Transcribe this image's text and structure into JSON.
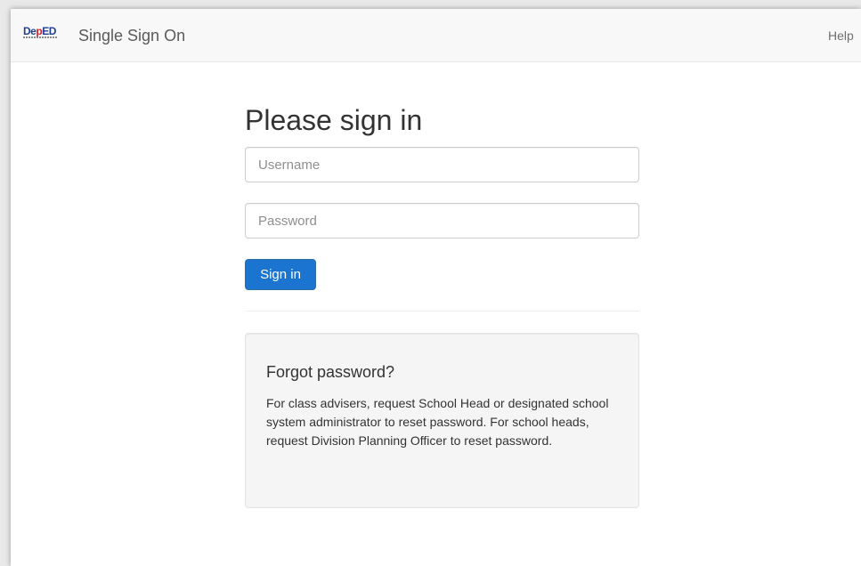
{
  "header": {
    "logo": "DepED",
    "brand": "Single Sign On",
    "help": "Help"
  },
  "form": {
    "title": "Please sign in",
    "username_placeholder": "Username",
    "password_placeholder": "Password",
    "submit_label": "Sign in"
  },
  "forgot": {
    "title": "Forgot password?",
    "text": "For class advisers, request School Head or designated school system administrator to reset password. For school heads, request Division Planning Officer to reset password."
  },
  "colors": {
    "primary_button": "#1b74cf",
    "navbar_bg": "#f8f8f8",
    "panel_bg": "#f5f5f5"
  }
}
